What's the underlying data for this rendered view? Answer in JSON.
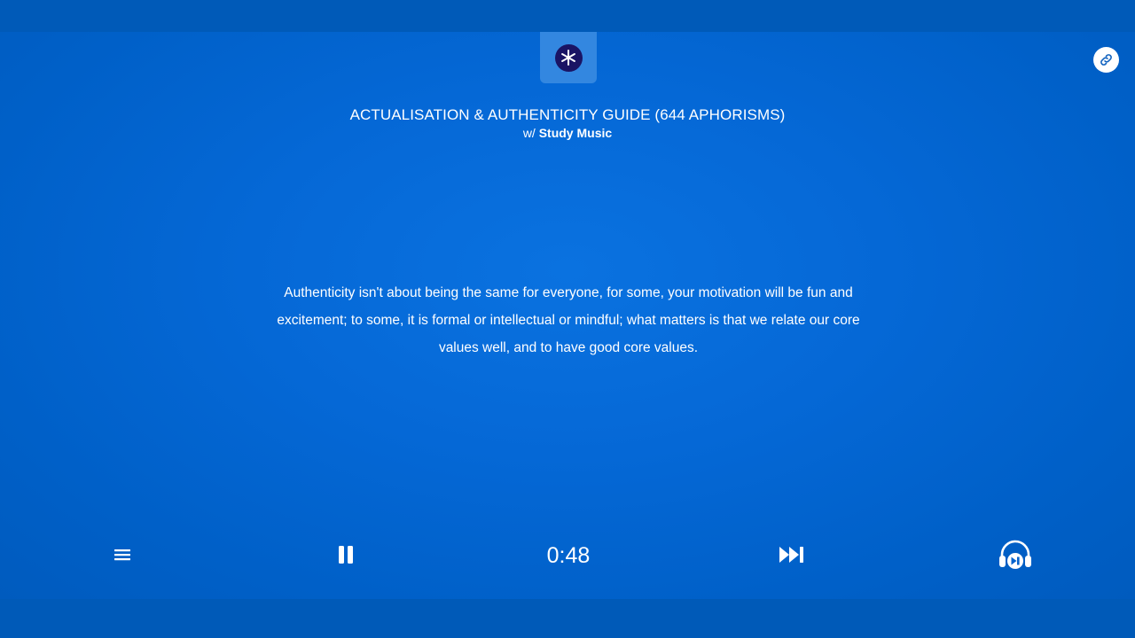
{
  "header": {
    "title": "ACTUALISATION & AUTHENTICITY GUIDE (644 APHORISMS)",
    "subtitle_prefix": "w/",
    "subtitle_music": "Study Music",
    "logo_icon": "asterisk-icon",
    "link_icon": "link-icon"
  },
  "quote": {
    "text": "Authenticity isn't about being the same for everyone, for some, your motivation will be fun and excitement; to some, it is formal or intellectual or mindful; what matters is that we relate our core values well, and to have good core values."
  },
  "player": {
    "elapsed": "0:48",
    "menu_icon": "menu-icon",
    "pause_icon": "pause-icon",
    "next_icon": "skip-next-icon",
    "audio_icon": "headphones-icon"
  },
  "colors": {
    "background": "#0568d6",
    "logo_tab": "#3387e0",
    "logo_circle": "#1a1464",
    "text": "#ffffff"
  }
}
